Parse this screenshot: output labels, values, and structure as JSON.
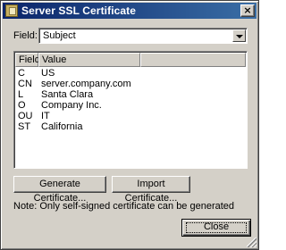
{
  "window": {
    "title": "Server SSL Certificate",
    "close_glyph": "×",
    "title_icon": "certificate-icon"
  },
  "field_selector": {
    "label": "Field:",
    "value": "Subject"
  },
  "table": {
    "columns": [
      "Field",
      "Value"
    ],
    "rows": [
      {
        "field": "C",
        "value": "US"
      },
      {
        "field": "CN",
        "value": "server.company.com"
      },
      {
        "field": "L",
        "value": "Santa Clara"
      },
      {
        "field": "O",
        "value": "Company Inc."
      },
      {
        "field": "OU",
        "value": "IT"
      },
      {
        "field": "ST",
        "value": "California"
      }
    ]
  },
  "buttons": {
    "generate": "Generate Certificate...",
    "import": "Import Certificate...",
    "close": "Close"
  },
  "note": "Note: Only self-signed certificate can be generated"
}
